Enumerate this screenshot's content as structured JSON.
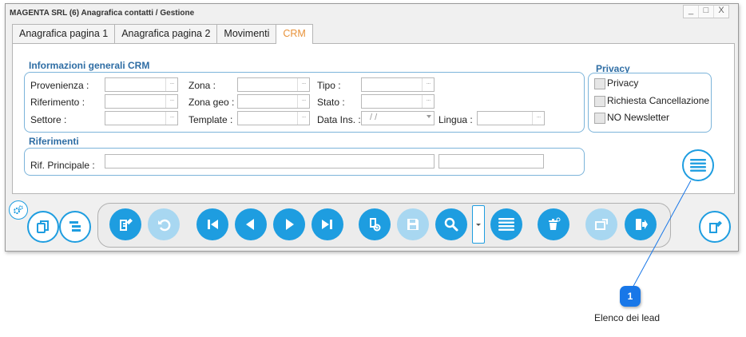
{
  "window": {
    "title": "MAGENTA SRL (6) Anagrafica contatti / Gestione",
    "buttons": [
      "_",
      "□",
      "X"
    ]
  },
  "tabs": [
    {
      "label": "Anagrafica pagina 1",
      "active": false
    },
    {
      "label": "Anagrafica pagina 2",
      "active": false
    },
    {
      "label": "Movimenti",
      "active": false
    },
    {
      "label": "CRM",
      "active": true
    }
  ],
  "crm": {
    "title": "Informazioni generali CRM",
    "provenienza": "Provenienza :",
    "riferimento": "Riferimento :",
    "settore": "Settore :",
    "zona": "Zona :",
    "zona_geo": "Zona geo :",
    "template": "Template :",
    "tipo": "Tipo :",
    "stato": "Stato :",
    "data_ins": "Data Ins. :",
    "data_ins_value": "/  /",
    "lingua": "Lingua :",
    "dots": "···"
  },
  "riferimenti": {
    "title": "Riferimenti",
    "rif_principale": "Rif. Principale :"
  },
  "privacy": {
    "title": "Privacy",
    "items": [
      "Privacy",
      "Richiesta Cancellazione",
      "NO Newsletter"
    ]
  },
  "callout": {
    "number": "1",
    "text": "Elenco dei lead"
  },
  "colors": {
    "accent": "#1e9de0",
    "accent_disabled": "#a8d7f1",
    "section_title": "#2e6da4",
    "active_tab": "#e8923a",
    "callout": "#1877e8"
  }
}
